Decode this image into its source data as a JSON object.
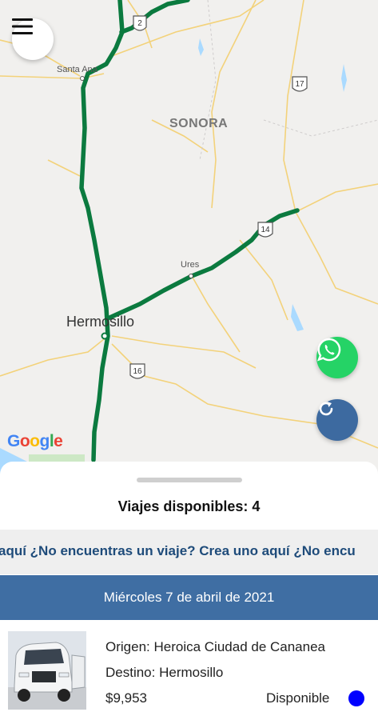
{
  "map": {
    "labels": {
      "state": "SONORA",
      "city_main": "Hermosillo",
      "town_santa_ana": "Santa Ana",
      "town_ures": "Ures"
    },
    "highway_shields": [
      "2",
      "17",
      "14",
      "16"
    ],
    "attribution": "Google",
    "route_color": "#0b7a3f"
  },
  "buttons": {
    "menu_icon": "hamburger-menu-icon",
    "whatsapp_icon": "whatsapp-icon",
    "refresh_icon": "refresh-icon"
  },
  "sheet": {
    "title": "Viajes disponibles: 4",
    "marquee": "aquí   ¿No encuentras un viaje? Crea uno aquí   ¿No encu",
    "date_header": "Miércoles 7 de abril de 2021"
  },
  "trip": {
    "origin": "Origen: Heroica Ciudad de Cananea",
    "destination": "Destino: Hermosillo",
    "price": "$9,953",
    "status": "Disponible",
    "status_color": "#0000ff"
  }
}
